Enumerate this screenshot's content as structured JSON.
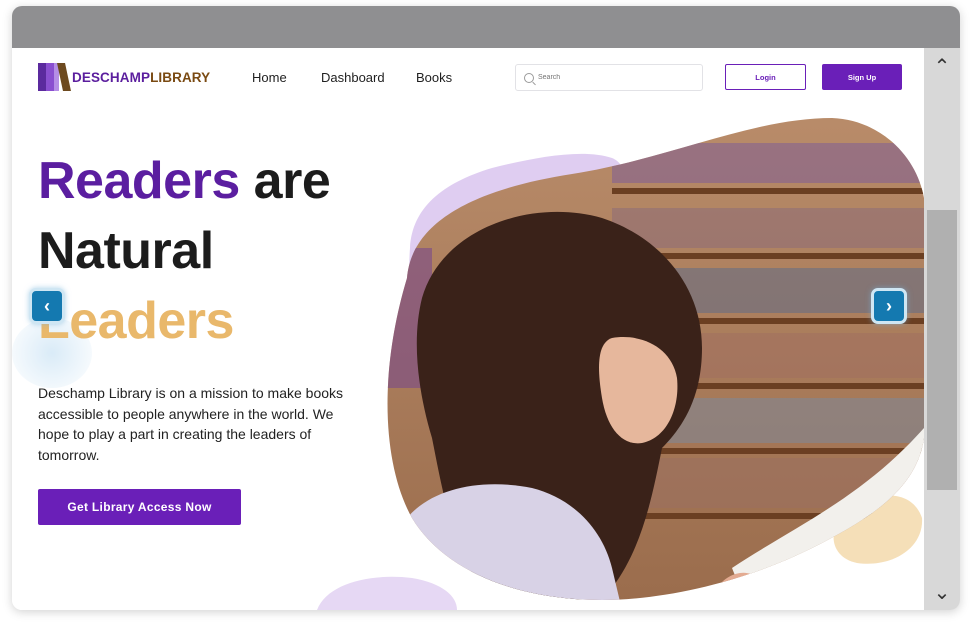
{
  "brand": {
    "name_part1": "DESCHAMP",
    "name_part2": "LIBRARY"
  },
  "nav": {
    "home": "Home",
    "dashboard": "Dashboard",
    "books": "Books"
  },
  "search": {
    "placeholder": "Search"
  },
  "auth": {
    "login": "Login",
    "signup": "Sign Up"
  },
  "hero": {
    "line1_accent": "Readers",
    "line1_rest": " are",
    "line2": "Natural",
    "line3": "Leaders",
    "description": "Deschamp Library is on a mission to make books accessible to people anywhere in the world. We hope to play a part in creating the leaders of tomorrow.",
    "cta": "Get Library Access Now"
  },
  "carousel": {
    "prev_icon": "chevron-left-icon",
    "next_icon": "chevron-right-icon"
  },
  "colors": {
    "primary": "#6a1fb8",
    "accent_gold": "#e9b86b",
    "arrow_blue": "#1479b0"
  }
}
